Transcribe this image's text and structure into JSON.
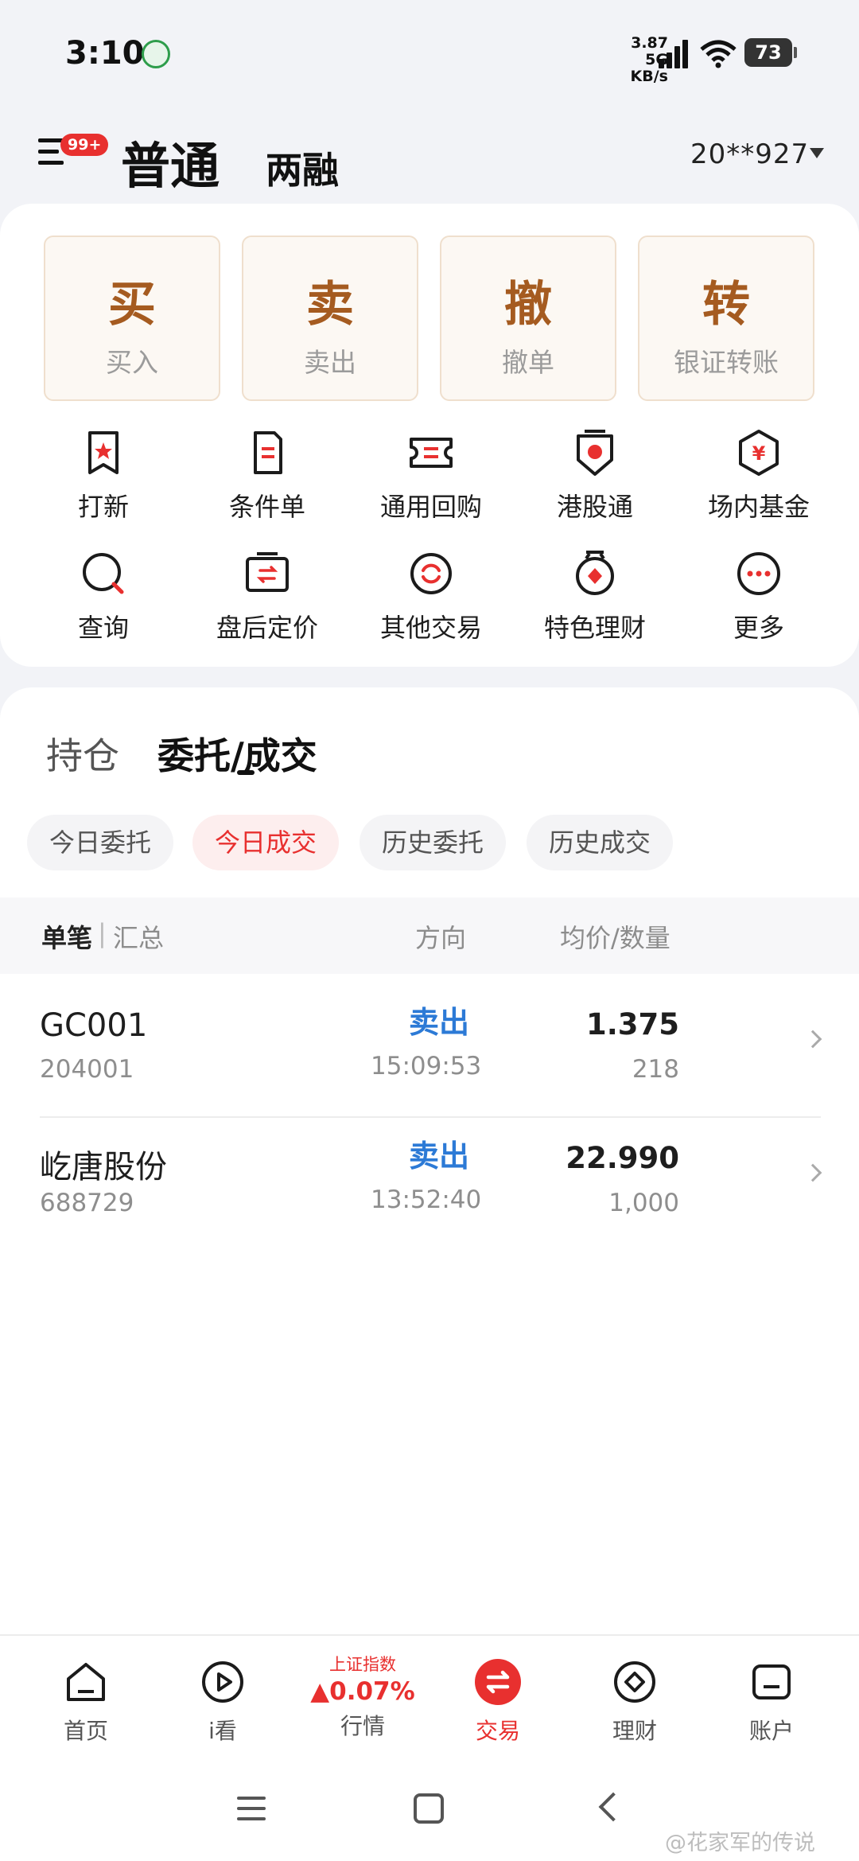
{
  "status_bar": {
    "time": "3:10",
    "net_speed": "3.87",
    "net_unit": "KB/s",
    "net_type": "5G",
    "wifi_sub": "6",
    "battery": "73"
  },
  "header": {
    "badge": "99+",
    "tab_active": "普通",
    "tab_other": "两融",
    "account": "20**927"
  },
  "big_actions": [
    {
      "big": "买",
      "small": "买入"
    },
    {
      "big": "卖",
      "small": "卖出"
    },
    {
      "big": "撤",
      "small": "撤单"
    },
    {
      "big": "转",
      "small": "银证转账"
    }
  ],
  "icons_row1": [
    {
      "label": "打新",
      "icon": "ipo-icon"
    },
    {
      "label": "条件单",
      "icon": "condition-order-icon"
    },
    {
      "label": "通用回购",
      "icon": "repo-icon"
    },
    {
      "label": "港股通",
      "icon": "hk-connect-icon"
    },
    {
      "label": "场内基金",
      "icon": "fund-icon"
    }
  ],
  "icons_row2": [
    {
      "label": "查询",
      "icon": "query-icon"
    },
    {
      "label": "盘后定价",
      "icon": "after-hours-icon"
    },
    {
      "label": "其他交易",
      "icon": "other-trade-icon"
    },
    {
      "label": "特色理财",
      "icon": "wealth-icon"
    },
    {
      "label": "更多",
      "icon": "more-icon"
    }
  ],
  "segments": {
    "holding": "持仓",
    "entrust": "委托/成交"
  },
  "chips": [
    "今日委托",
    "今日成交",
    "历史委托",
    "历史成交"
  ],
  "table": {
    "single": "单笔",
    "sep": "|",
    "summary": "汇总",
    "direction": "方向",
    "price_qty": "均价/数量",
    "rows": [
      {
        "name": "GC001",
        "code": "204001",
        "direction": "卖出",
        "time": "15:09:53",
        "price": "1.375",
        "qty": "218"
      },
      {
        "name": "屹唐股份",
        "code": "688729",
        "direction": "卖出",
        "time": "13:52:40",
        "price": "22.990",
        "qty": "1,000"
      }
    ]
  },
  "bottom_nav": {
    "home": "首页",
    "watch": "i看",
    "market_name": "上证指数",
    "market_value": "▲0.07%",
    "market": "行情",
    "trade": "交易",
    "wealth": "理财",
    "account": "账户"
  },
  "watermark": "@花家军的传说",
  "colors": {
    "accent_red": "#e8302f",
    "action_brown": "#a55b20",
    "sell_blue": "#2c7ad6"
  }
}
